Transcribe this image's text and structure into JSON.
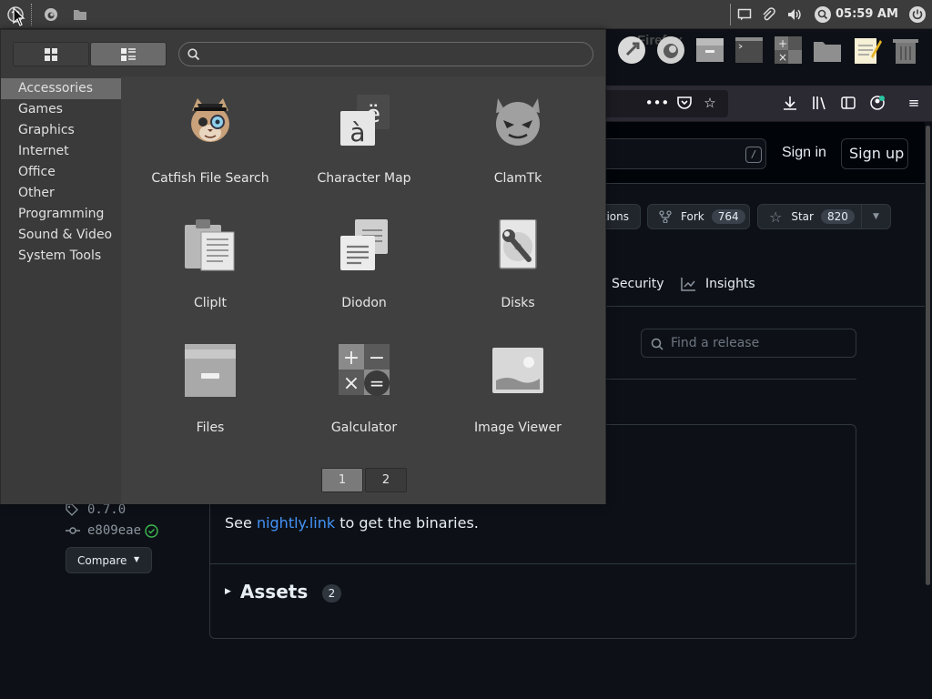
{
  "panel": {
    "clock": "05:59 AM"
  },
  "firefox": {
    "title_fragment": "Firefox"
  },
  "github": {
    "sign_in": "Sign in",
    "sign_up": "Sign up",
    "search_shortcut": "/",
    "actions_fragment": "tions",
    "fork_label": "Fork",
    "fork_count": "764",
    "star_label": "Star",
    "star_count": "820",
    "tabs": [
      {
        "label": "Security"
      },
      {
        "label": "Insights"
      }
    ],
    "find_release_placeholder": "Find a release",
    "tag": "0.7.0",
    "commit": "e809eae",
    "compare_label": "Compare",
    "note_prefix": "See ",
    "note_link": "nightly.link",
    "note_suffix": " to get the binaries.",
    "assets_label": "Assets",
    "assets_count": "2"
  },
  "menu": {
    "search_placeholder": "",
    "categories": [
      {
        "label": "Accessories"
      },
      {
        "label": "Games"
      },
      {
        "label": "Graphics"
      },
      {
        "label": "Internet"
      },
      {
        "label": "Office"
      },
      {
        "label": "Other"
      },
      {
        "label": "Programming"
      },
      {
        "label": "Sound & Video"
      },
      {
        "label": "System Tools"
      }
    ],
    "apps": [
      {
        "label": "Catfish File Search",
        "icon": "catfish-icon"
      },
      {
        "label": "Character Map",
        "icon": "character-map-icon"
      },
      {
        "label": "ClamTk",
        "icon": "clamtk-icon"
      },
      {
        "label": "ClipIt",
        "icon": "clipboard-icon"
      },
      {
        "label": "Diodon",
        "icon": "diodon-icon"
      },
      {
        "label": "Disks",
        "icon": "disks-icon"
      },
      {
        "label": "Files",
        "icon": "files-icon"
      },
      {
        "label": "Galculator",
        "icon": "calculator-icon"
      },
      {
        "label": "Image Viewer",
        "icon": "image-viewer-icon"
      }
    ],
    "charmap_glyphs": {
      "top": "ë",
      "bottom": "à"
    },
    "calc_glyphs": {
      "plus": "+",
      "minus": "−",
      "times": "×",
      "equals": "="
    },
    "pages": [
      {
        "label": "1"
      },
      {
        "label": "2"
      }
    ],
    "active_page": "1"
  }
}
